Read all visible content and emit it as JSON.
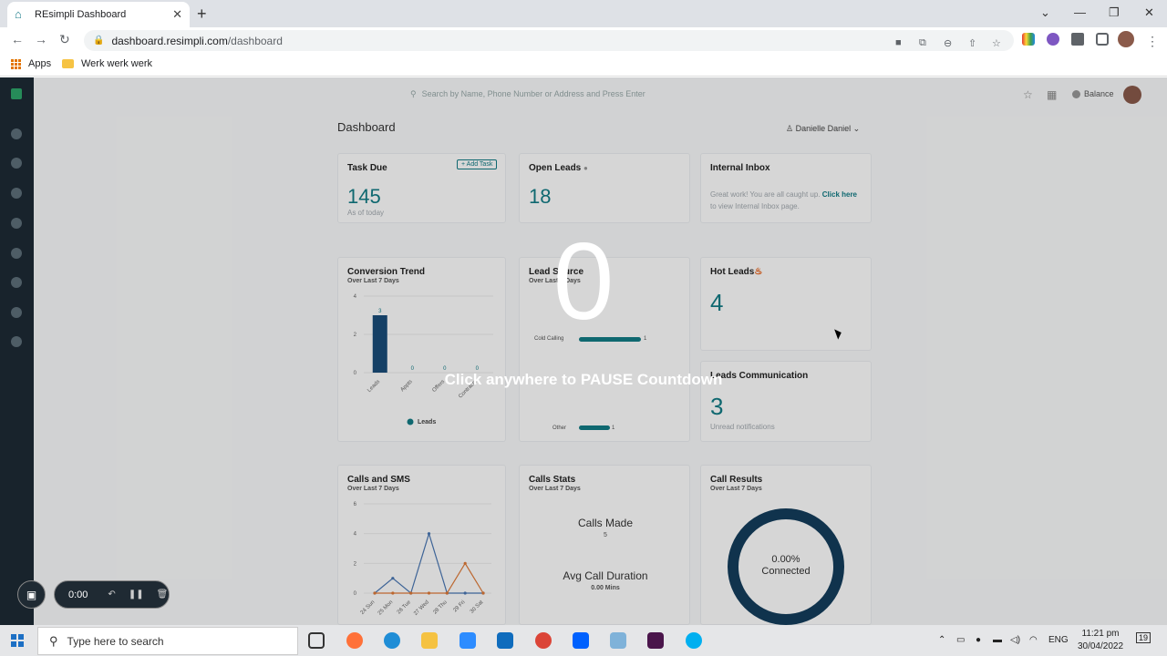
{
  "browser": {
    "tab_title": "REsimpli Dashboard",
    "url_domain": "dashboard.resimpli.com",
    "url_path": "/dashboard",
    "bookmarks": [
      "Apps",
      "Werk werk werk"
    ]
  },
  "app": {
    "search_placeholder": "Search by Name, Phone Number or Address and Press Enter",
    "balance_label": "Balance",
    "page_title": "Dashboard",
    "user_select": "Danielle Daniel",
    "cards": {
      "task_due": {
        "title": "Task Due",
        "value": "145",
        "caption": "As of today",
        "add_label": "+ Add Task"
      },
      "open_leads": {
        "title": "Open Leads",
        "value": "18"
      },
      "internal_inbox": {
        "title": "Internal Inbox",
        "text1": "Great work! You are all caught up.",
        "link1": "Click here",
        "text2": "to view Internal Inbox page."
      },
      "conversion_trend": {
        "title": "Conversion Trend",
        "subtitle": "Over Last 7 Days"
      },
      "lead_source": {
        "title": "Lead Source",
        "subtitle": "Over Last 7 Days",
        "bar1_label": "Cold Calling",
        "bar1_value": "1",
        "bar2_label": "Other",
        "bar2_value": "1"
      },
      "hot_leads": {
        "title": "Hot Leads",
        "value": "4"
      },
      "leads_communication": {
        "title": "Leads Communication",
        "value": "3",
        "caption": "Unread notifications"
      },
      "calls_sms": {
        "title": "Calls and SMS",
        "subtitle": "Over Last 7 Days"
      },
      "calls_stats": {
        "title": "Calls Stats",
        "subtitle": "Over Last 7 Days",
        "made_label": "Calls Made",
        "made_value": "5",
        "avg_label": "Avg Call Duration",
        "avg_value": "0.00 Mins"
      },
      "call_results": {
        "title": "Call Results",
        "subtitle": "Over Last 7 Days",
        "percent": "0.00%",
        "label": "Connected"
      }
    }
  },
  "chart_data": [
    {
      "type": "bar",
      "title": "Conversion Trend",
      "categories": [
        "Leads",
        "Appts",
        "Offers",
        "Contracts"
      ],
      "values": [
        3,
        0,
        0,
        0
      ],
      "ylim": [
        0,
        4
      ],
      "yticks": [
        0,
        2,
        4
      ],
      "legend": [
        "Leads"
      ],
      "colors": [
        "#1a4d7a"
      ]
    },
    {
      "type": "line",
      "title": "Calls and SMS",
      "x": [
        "24 Sun",
        "25 Mon",
        "26 Tue",
        "27 Wed",
        "28 Thu",
        "29 Fri",
        "30 Sat"
      ],
      "ylim": [
        0,
        6
      ],
      "yticks": [
        0,
        2,
        4,
        6
      ],
      "series": [
        {
          "values": [
            0,
            1,
            0,
            4,
            0,
            0,
            0
          ],
          "color": "#4a78b4"
        },
        {
          "values": [
            0,
            0,
            0,
            0,
            0,
            2,
            0
          ],
          "color": "#e07b39"
        }
      ]
    }
  ],
  "overlay": {
    "countdown": "0",
    "instruction": "Click anywhere to PAUSE Countdown"
  },
  "recorder": {
    "time": "0:00"
  },
  "taskbar": {
    "search_placeholder": "Type here to search",
    "language": "ENG",
    "time": "11:21 pm",
    "date": "30/04/2022",
    "notifications": "19"
  }
}
